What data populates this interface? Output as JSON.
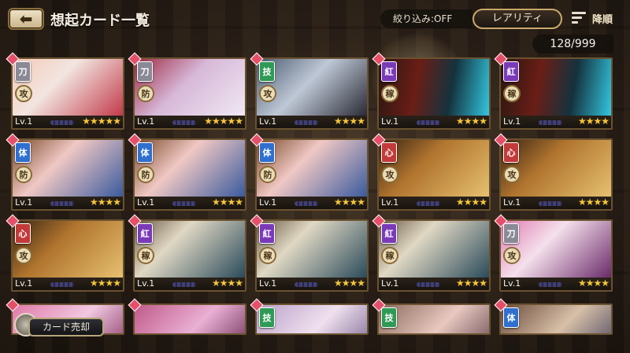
{
  "header": {
    "title": "想起カード一覧",
    "filter_label": "絞り込み:OFF",
    "rarity_button": "レアリティ",
    "sort_label": "降順",
    "count": "128/999"
  },
  "footer": {
    "sell_button": "カード売却"
  },
  "colors": {
    "atk": "#8a8a96",
    "tech": "#2f9a55",
    "body": "#2f6fcf",
    "red": "#c23a3a",
    "purple": "#7a3ab8"
  },
  "cards": [
    {
      "level": "Lv.1",
      "stars": "★★★★★",
      "type": "刀",
      "type_color": "#8a8a96",
      "role": "攻",
      "art_bg": "linear-gradient(135deg,#f6c9b6,#f2e5e0 40%,#c23a4a)",
      "icon": "sword-icon"
    },
    {
      "level": "Lv.1",
      "stars": "★★★★★",
      "type": "刀",
      "type_color": "#8a8a96",
      "role": "防",
      "art_bg": "linear-gradient(135deg,#9e2a44,#d7b8d8 45%,#f0e8f3)",
      "icon": "sword-icon"
    },
    {
      "level": "Lv.1",
      "stars": "★★★★",
      "type": "技",
      "type_color": "#2f9a55",
      "role": "攻",
      "art_bg": "linear-gradient(135deg,#4a5a70,#bfc8d6 45%,#2a2a36)",
      "icon": "tech-icon"
    },
    {
      "level": "Lv.1",
      "stars": "★★★★",
      "type": "紅",
      "type_color": "#7a3ab8",
      "role": "稼",
      "art_bg": "linear-gradient(100deg,#2a1612,#6a1e16 35%,#14323e 65%,#33c7e0)",
      "icon": "crimson-icon"
    },
    {
      "level": "Lv.1",
      "stars": "★★★★",
      "type": "紅",
      "type_color": "#7a3ab8",
      "role": "稼",
      "art_bg": "linear-gradient(100deg,#2a1612,#6a1e16 35%,#14323e 65%,#33c7e0)",
      "icon": "crimson-icon"
    },
    {
      "level": "Lv.1",
      "stars": "★★★★",
      "type": "体",
      "type_color": "#2f6fcf",
      "role": "防",
      "art_bg": "linear-gradient(135deg,#7a4a2a,#f0c8c4 40%,#3a5a9e)",
      "icon": "body-icon"
    },
    {
      "level": "Lv.1",
      "stars": "★★★★",
      "type": "体",
      "type_color": "#2f6fcf",
      "role": "防",
      "art_bg": "linear-gradient(135deg,#7a4a2a,#f0c8c4 40%,#3a5a9e)",
      "icon": "body-icon"
    },
    {
      "level": "Lv.1",
      "stars": "★★★★",
      "type": "体",
      "type_color": "#2f6fcf",
      "role": "防",
      "art_bg": "linear-gradient(135deg,#7a4a2a,#f0c8c4 40%,#3a5a9e)",
      "icon": "body-icon"
    },
    {
      "level": "Lv.1",
      "stars": "★★★★",
      "type": "心",
      "type_color": "#c23a3a",
      "role": "攻",
      "art_bg": "linear-gradient(135deg,#3a2414,#b0742e 40%,#e6c070)",
      "icon": "heart-icon"
    },
    {
      "level": "Lv.1",
      "stars": "★★★★",
      "type": "心",
      "type_color": "#c23a3a",
      "role": "攻",
      "art_bg": "linear-gradient(135deg,#3a2414,#b0742e 40%,#e6c070)",
      "icon": "heart-icon"
    },
    {
      "level": "Lv.1",
      "stars": "★★★★",
      "type": "心",
      "type_color": "#c23a3a",
      "role": "攻",
      "art_bg": "linear-gradient(135deg,#3a2414,#b0742e 40%,#e6c070)",
      "icon": "heart-icon"
    },
    {
      "level": "Lv.1",
      "stars": "★★★★",
      "type": "紅",
      "type_color": "#7a3ab8",
      "role": "稼",
      "art_bg": "linear-gradient(135deg,#6a5a44,#e0d8c4 35%,#2a4a5a)",
      "icon": "crimson-icon"
    },
    {
      "level": "Lv.1",
      "stars": "★★★★",
      "type": "紅",
      "type_color": "#7a3ab8",
      "role": "稼",
      "art_bg": "linear-gradient(135deg,#6a5a44,#e0d8c4 35%,#2a4a5a)",
      "icon": "crimson-icon"
    },
    {
      "level": "Lv.1",
      "stars": "★★★★",
      "type": "紅",
      "type_color": "#7a3ab8",
      "role": "稼",
      "art_bg": "linear-gradient(135deg,#6a5a44,#e0d8c4 35%,#2a4a5a)",
      "icon": "crimson-icon"
    },
    {
      "level": "Lv.1",
      "stars": "★★★★",
      "type": "刀",
      "type_color": "#8a8a96",
      "role": "攻",
      "art_bg": "linear-gradient(135deg,#e07ab0,#f5e0ec 40%,#6a2a6a)",
      "icon": "sword-icon"
    },
    {
      "level": "",
      "stars": "",
      "type": "",
      "type_color": "#8a8a96",
      "role": "",
      "art_bg": "linear-gradient(135deg,#e07aa8,#f2c8e0 50%,#7a2a5a)",
      "icon": ""
    },
    {
      "level": "",
      "stars": "",
      "type": "",
      "type_color": "#8a8a96",
      "role": "",
      "art_bg": "linear-gradient(135deg,#c05a8a,#eab0d4 50%,#5a2048)",
      "icon": ""
    },
    {
      "level": "",
      "stars": "",
      "type": "技",
      "type_color": "#2f9a55",
      "role": "",
      "art_bg": "linear-gradient(135deg,#b8a0c8,#f0e0ee 50%,#6a5a88)",
      "icon": "tech-icon"
    },
    {
      "level": "",
      "stars": "",
      "type": "技",
      "type_color": "#2f9a55",
      "role": "",
      "art_bg": "linear-gradient(135deg,#8a6a5a,#e8c8c0 50%,#5a3a44)",
      "icon": "tech-icon"
    },
    {
      "level": "",
      "stars": "",
      "type": "体",
      "type_color": "#2f6fcf",
      "role": "",
      "art_bg": "linear-gradient(135deg,#6a4a3a,#d8c0a8 50%,#3a3a5a)",
      "icon": "body-icon"
    }
  ]
}
